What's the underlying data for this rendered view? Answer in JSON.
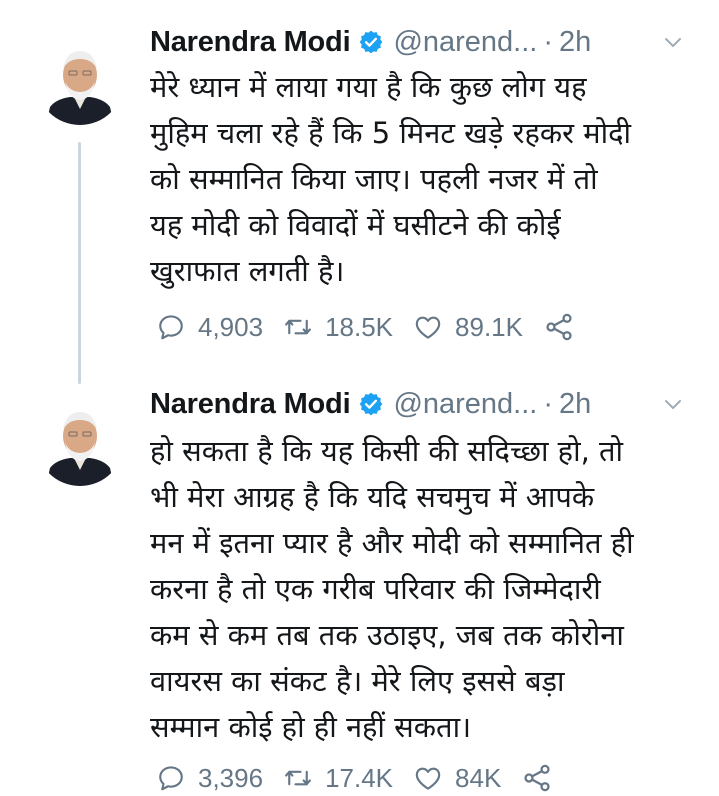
{
  "tweets": [
    {
      "author": {
        "name": "Narendra Modi",
        "handle": "@narend...",
        "separator": "·",
        "time": "2h"
      },
      "text": "मेरे ध्यान में लाया गया है कि कुछ लोग यह\nमुहिम चला रहे हैं कि 5 मिनट खड़े रहकर मोदी\nको सम्मानित किया जाए। पहली नजर में तो\nयह मोदी को विवादों में घसीटने की कोई\nखुराफात लगती है।",
      "stats": {
        "replies": "4,903",
        "retweets": "18.5K",
        "likes": "89.1K"
      }
    },
    {
      "author": {
        "name": "Narendra Modi",
        "handle": "@narend...",
        "separator": "·",
        "time": "2h"
      },
      "text": "हो सकता है कि यह किसी की सदिच्छा हो, तो\nभी मेरा आग्रह है कि यदि सचमुच में आपके\nमन में इतना प्यार है और मोदी को सम्मानित ही\nकरना है तो एक गरीब परिवार की जिम्मेदारी\nकम से कम तब तक उठाइए, जब तक कोरोना\nवायरस का संकट है। मेरे लिए इससे बड़ा\nसम्मान कोई हो ही नहीं सकता।",
      "stats": {
        "replies": "3,396",
        "retweets": "17.4K",
        "likes": "84K"
      }
    }
  ],
  "icons": {
    "verified": "verified-badge-icon",
    "more": "chevron-down-icon",
    "reply": "reply-icon",
    "retweet": "retweet-icon",
    "like": "heart-icon",
    "share": "share-icon"
  },
  "colors": {
    "text": "#14171a",
    "secondary": "#657786",
    "verified": "#1da1f2",
    "thread_line": "#ccd6dd",
    "background": "#ffffff"
  }
}
